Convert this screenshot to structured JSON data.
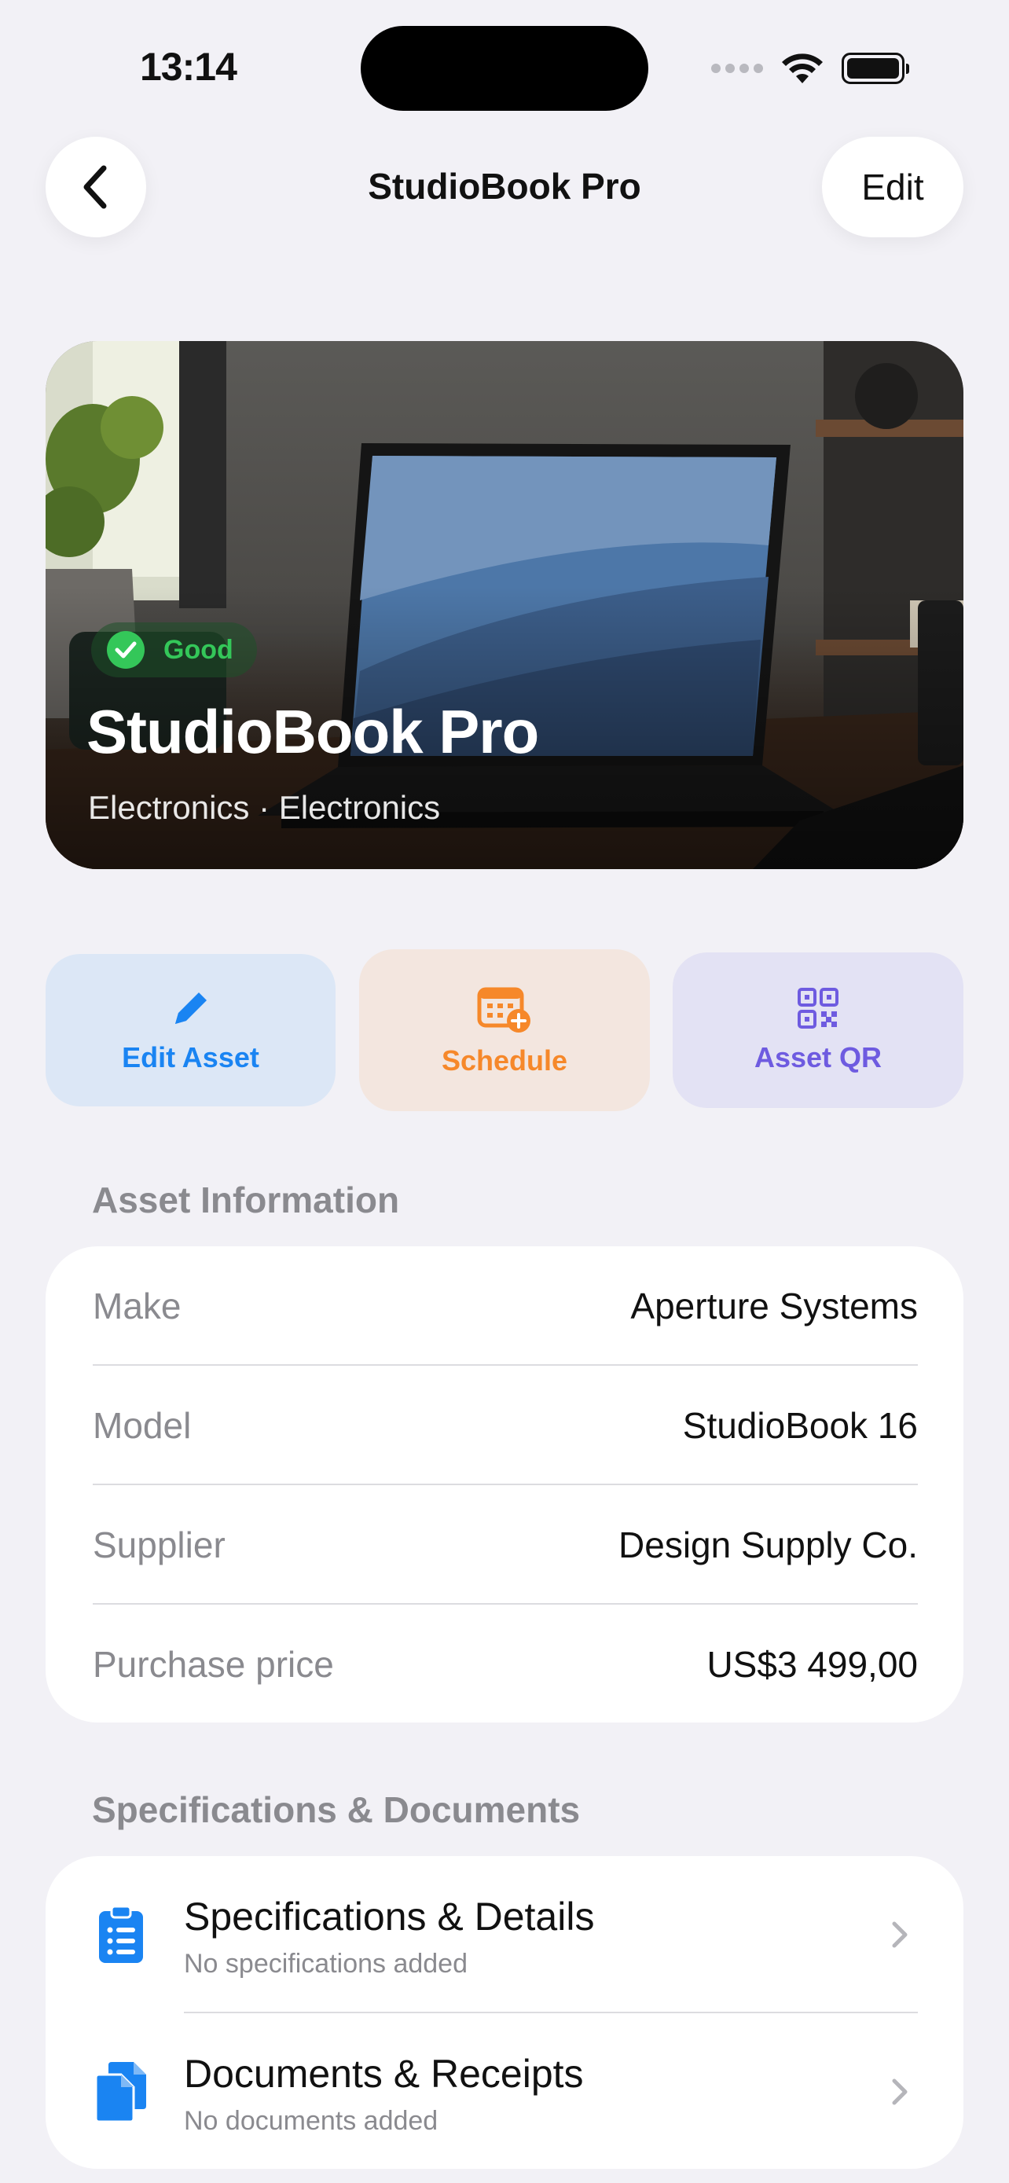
{
  "status": {
    "time": "13:14"
  },
  "nav": {
    "title": "StudioBook Pro",
    "edit_label": "Edit"
  },
  "hero": {
    "condition": "Good",
    "title": "StudioBook Pro",
    "subtitle": "Electronics · Electronics"
  },
  "actions": [
    {
      "label": "Edit Asset",
      "icon": "pencil-icon",
      "color": "#1a84f2"
    },
    {
      "label": "Schedule",
      "icon": "calendar-add-icon",
      "color": "#f6882a"
    },
    {
      "label": "Asset QR",
      "icon": "qr-code-icon",
      "color": "#6e5be0"
    }
  ],
  "asset_info": {
    "header": "Asset Information",
    "rows": [
      {
        "label": "Make",
        "value": "Aperture Systems"
      },
      {
        "label": "Model",
        "value": "StudioBook 16"
      },
      {
        "label": "Supplier",
        "value": "Design Supply Co."
      },
      {
        "label": "Purchase price",
        "value": "US$3 499,00"
      }
    ]
  },
  "docs": {
    "header": "Specifications & Documents",
    "items": [
      {
        "title": "Specifications & Details",
        "subtitle": "No specifications added",
        "icon": "clipboard-list-icon"
      },
      {
        "title": "Documents & Receipts",
        "subtitle": "No documents added",
        "icon": "documents-icon"
      }
    ]
  },
  "colors": {
    "accent_blue": "#1a84f2",
    "good_green": "#34c759",
    "background": "#f2f1f6"
  }
}
